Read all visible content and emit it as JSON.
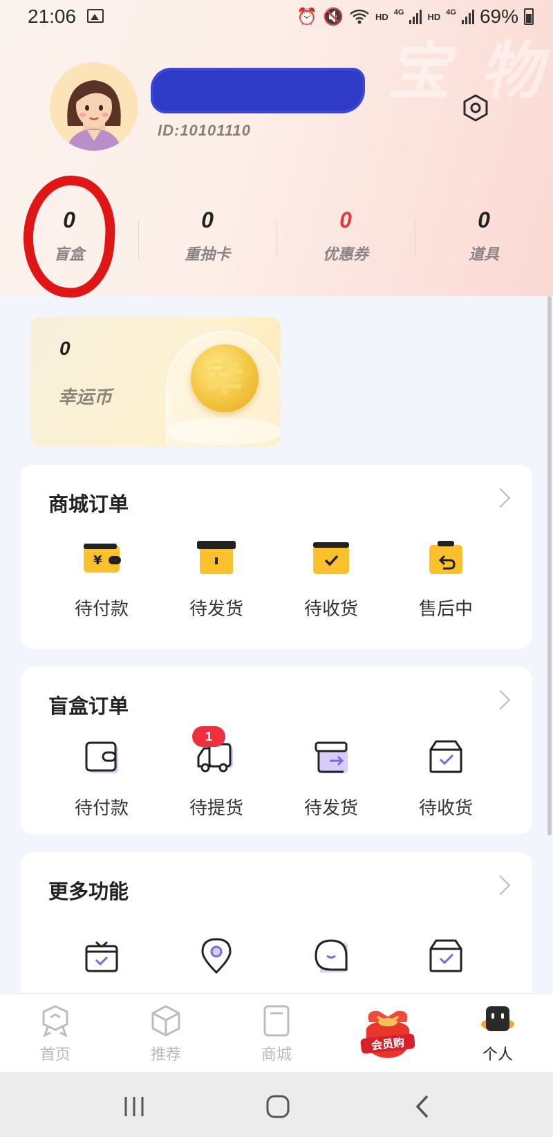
{
  "status_bar": {
    "time": "21:06",
    "network_hd_1": "HD",
    "network_4g_1": "4G",
    "network_hd_2": "HD",
    "network_4g_2": "4G",
    "battery": "69%",
    "icons": [
      "gallery-icon",
      "alarm-icon",
      "mute-icon",
      "wifi-icon",
      "signal-icon",
      "battery-icon"
    ]
  },
  "profile": {
    "user_id": "ID:10101110",
    "username_redacted": true
  },
  "stats": [
    {
      "value": "0",
      "label": "盲盒",
      "highlight": false
    },
    {
      "value": "0",
      "label": "重抽卡",
      "highlight": false
    },
    {
      "value": "0",
      "label": "优惠券",
      "highlight": true
    },
    {
      "value": "0",
      "label": "道具",
      "highlight": false
    }
  ],
  "lucky_coin": {
    "value": "0",
    "label": "幸运币",
    "coin_char": "幸"
  },
  "mall_orders": {
    "title": "商城订单",
    "items": [
      {
        "label": "待付款",
        "icon": "wallet-yen-icon"
      },
      {
        "label": "待发货",
        "icon": "box-icon"
      },
      {
        "label": "待收货",
        "icon": "box-check-icon"
      },
      {
        "label": "售后中",
        "icon": "box-return-icon"
      }
    ]
  },
  "blindbox_orders": {
    "title": "盲盒订单",
    "items": [
      {
        "label": "待付款",
        "icon": "wallet-icon"
      },
      {
        "label": "待提货",
        "icon": "truck-icon",
        "badge": "1"
      },
      {
        "label": "待发货",
        "icon": "box-arrow-icon"
      },
      {
        "label": "待收货",
        "icon": "box-check-icon"
      }
    ]
  },
  "more_features": {
    "title": "更多功能",
    "items": [
      {
        "icon": "gift-check-icon"
      },
      {
        "icon": "location-icon"
      },
      {
        "icon": "chat-icon"
      },
      {
        "icon": "box-check-icon"
      }
    ]
  },
  "tabbar": [
    {
      "label": "首页",
      "icon": "home-badge-icon",
      "active": false
    },
    {
      "label": "推荐",
      "icon": "cube-icon",
      "active": false
    },
    {
      "label": "商城",
      "icon": "store-icon",
      "active": false
    },
    {
      "label": "",
      "icon": "vip-bag-icon",
      "active": false,
      "badge_text": "会员购"
    },
    {
      "label": "个人",
      "icon": "profile-face-icon",
      "active": true
    }
  ],
  "colors": {
    "accent_red": "#ee2f3c",
    "icon_yellow": "#fbc02d",
    "icon_purple": "#c9b7f4"
  }
}
